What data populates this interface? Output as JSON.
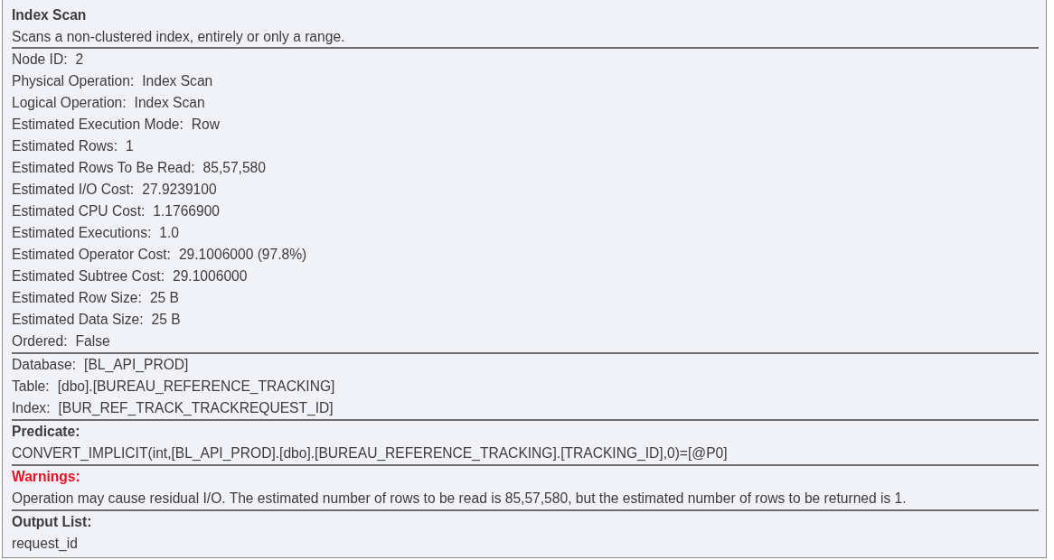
{
  "tooltip": {
    "title": "Index Scan",
    "description": "Scans a non-clustered index, entirely or only a range.",
    "property_groups": [
      {
        "properties": [
          {
            "label": "Node ID:",
            "value": "2"
          },
          {
            "label": "Physical Operation:",
            "value": "Index Scan"
          },
          {
            "label": "Logical Operation:",
            "value": "Index Scan"
          },
          {
            "label": "Estimated Execution Mode:",
            "value": "Row"
          },
          {
            "label": "Estimated Rows:",
            "value": "1"
          },
          {
            "label": "Estimated Rows To Be Read:",
            "value": "85,57,580"
          },
          {
            "label": "Estimated I/O Cost:",
            "value": "27.9239100"
          },
          {
            "label": "Estimated CPU Cost:",
            "value": "1.1766900"
          },
          {
            "label": "Estimated Executions:",
            "value": "1.0"
          },
          {
            "label": "Estimated Operator Cost:",
            "value": "29.1006000 (97.8%)"
          },
          {
            "label": "Estimated Subtree Cost:",
            "value": "29.1006000"
          },
          {
            "label": "Estimated Row Size:",
            "value": "25 B"
          },
          {
            "label": "Estimated Data Size:",
            "value": "25 B"
          },
          {
            "label": "Ordered:",
            "value": "False"
          }
        ]
      },
      {
        "properties": [
          {
            "label": "Database:",
            "value": "[BL_API_PROD]"
          },
          {
            "label": "Table:",
            "value": "[dbo].[BUREAU_REFERENCE_TRACKING]"
          },
          {
            "label": "Index:",
            "value": "[BUR_REF_TRACK_TRACKREQUEST_ID]"
          }
        ]
      }
    ],
    "sections": [
      {
        "kind": "normal",
        "heading": "Predicate:",
        "text": "CONVERT_IMPLICIT(int,[BL_API_PROD].[dbo].[BUREAU_REFERENCE_TRACKING].[TRACKING_ID],0)=[@P0]"
      },
      {
        "kind": "warning",
        "heading": "Warnings:",
        "text": "Operation may cause residual I/O. The estimated number of rows to be read is 85,57,580, but the estimated number of rows to be returned is 1."
      },
      {
        "kind": "normal",
        "heading": "Output List:",
        "text": "request_id"
      }
    ]
  }
}
